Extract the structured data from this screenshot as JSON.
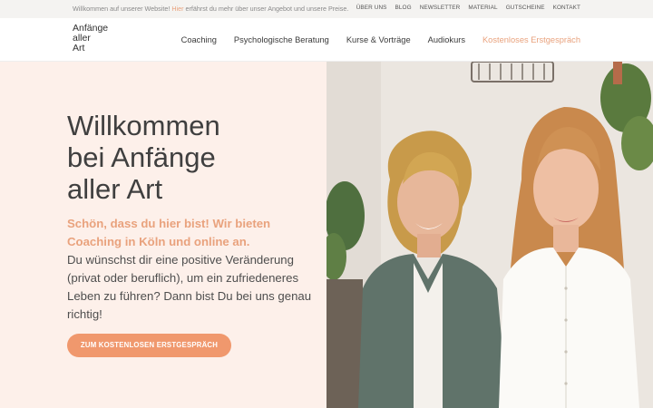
{
  "topbar": {
    "welcome_before": "Willkommen auf unserer Website!",
    "welcome_link": "Hier",
    "welcome_after": "erfährst du mehr über unser Angebot und unsere Preise.",
    "nav": [
      "ÜBER UNS",
      "BLOG",
      "NEWSLETTER",
      "MATERIAL",
      "GUTSCHEINE",
      "KONTAKT"
    ]
  },
  "header": {
    "logo": [
      "Anfänge",
      "aller",
      "Art"
    ],
    "nav": [
      "Coaching",
      "Psychologische Beratung",
      "Kurse & Vorträge",
      "Audiokurs"
    ],
    "cta": "Kostenloses Erstgespräch"
  },
  "hero": {
    "title": [
      "Willkommen",
      "bei Anfänge",
      "aller Art"
    ],
    "subtitle": "Schön, dass du hier bist! Wir bieten Coaching in Köln und online an.",
    "text": "Du wünschst dir eine positive Veränderung (privat oder beruflich), um ein zufriedeneres Leben zu führen? Dann bist Du bei uns genau richtig!",
    "button": "ZUM KOSTENLOSEN ERSTGESPRÄCH"
  },
  "colors": {
    "accent": "#e9a27d",
    "button": "#f0986d",
    "hero_bg": "#fdf0ea",
    "topbar_bg": "#f4f3f1"
  }
}
